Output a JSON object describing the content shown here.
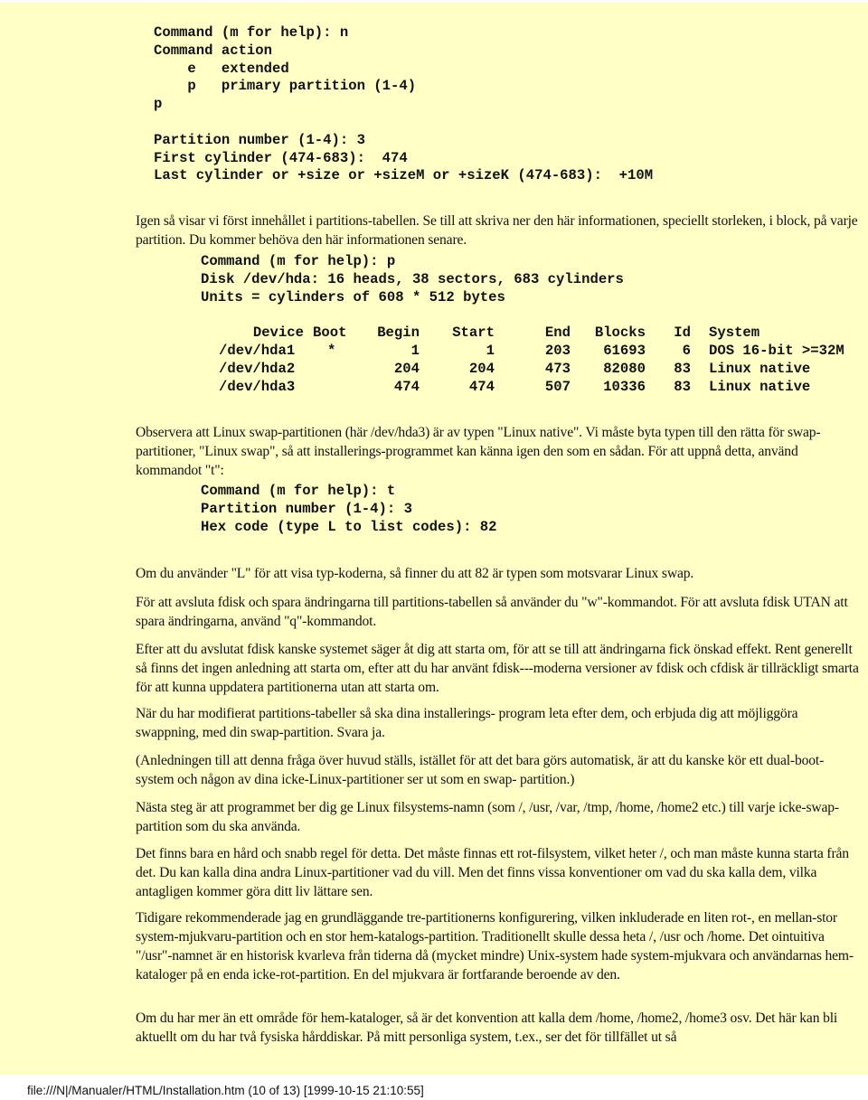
{
  "code_block_1": {
    "lines": [
      "Command (m for help): n",
      "Command action",
      "    e   extended",
      "    p   primary partition (1-4)",
      "p",
      "",
      "Partition number (1-4): 3",
      "First cylinder (474-683):  474",
      "Last cylinder or +size or +sizeM or +sizeK (474-683):  +10M"
    ]
  },
  "paragraph_1": "Igen så visar vi först innehållet i partitions-tabellen. Se till att skriva ner den här informationen, speciellt storleken, i block, på varje partition. Du kommer behöva den här informationen senare.",
  "code_block_2": {
    "lines": [
      "Command (m for help): p",
      "Disk /dev/hda: 16 heads, 38 sectors, 683 cylinders",
      "Units = cylinders of 608 * 512 bytes"
    ]
  },
  "partition_table": {
    "headers": [
      "Device",
      "Boot",
      "Begin",
      "Start",
      "End",
      "Blocks",
      "Id",
      "System"
    ],
    "rows": [
      [
        "/dev/hda1",
        "*",
        "1",
        "1",
        "203",
        "61693",
        "6",
        "DOS 16-bit >=32M"
      ],
      [
        "/dev/hda2",
        "",
        "204",
        "204",
        "473",
        "82080",
        "83",
        "Linux native"
      ],
      [
        "/dev/hda3",
        "",
        "474",
        "474",
        "507",
        "10336",
        "83",
        "Linux native"
      ]
    ]
  },
  "paragraph_2": "Observera att Linux swap-partitionen (här /dev/hda3) är av typen \"Linux native\". Vi måste byta typen till den rätta för swap- partitioner, \"Linux swap\", så att installerings-programmet kan känna igen den som en sådan. För att uppnå detta, använd kommandot \"t\":",
  "code_block_3": {
    "lines": [
      "Command (m for help): t",
      "Partition number (1-4): 3",
      "Hex code (type L to list codes): 82"
    ]
  },
  "paragraphs": [
    "Om du använder \"L\" för att visa typ-koderna, så finner du att 82 är typen som motsvarar Linux swap.",
    "För att avsluta fdisk och spara ändringarna till partitions-tabellen så använder du \"w\"-kommandot. För att avsluta fdisk UTAN att spara ändringarna, använd \"q\"-kommandot.",
    "Efter att du avslutat fdisk kanske systemet säger åt dig att starta om, för att se till att ändringarna fick önskad effekt. Rent generellt så finns det ingen anledning att starta om, efter att du har använt fdisk---moderna versioner av fdisk och cfdisk är tillräckligt smarta för att kunna uppdatera partitionerna utan att starta om.",
    "När du har modifierat partitions-tabeller så ska dina installerings- program leta efter dem, och erbjuda dig att möjliggöra swappning, med din swap-partition. Svara ja.",
    "(Anledningen till att denna fråga över huvud ställs, istället för att det bara görs automatisk, är att du kanske kör ett dual-boot-system och någon av dina icke-Linux-partitioner ser ut som en swap- partition.)",
    "Nästa steg är att programmet ber dig ge Linux filsystems-namn (som /, /usr, /var, /tmp, /home, /home2 etc.) till varje icke-swap-partition som du ska använda.",
    "Det finns bara en hård och snabb regel för detta. Det måste finnas ett rot-filsystem, vilket heter /, och man måste kunna starta från det. Du kan kalla dina andra Linux-partitioner vad du vill. Men det finns vissa konventioner om vad du ska kalla dem, vilka antagligen kommer göra ditt liv lättare sen.",
    "Tidigare rekommenderade jag en grundläggande tre-partitionerns konfigurering, vilken inkluderade en liten rot-, en mellan-stor system-mjukvaru-partition och en stor hem-katalogs-partition. Traditionellt skulle dessa heta /, /usr och /home. Det ointuitiva \"/usr\"-namnet är en historisk kvarleva från tiderna då (mycket mindre) Unix-system hade system-mjukvara och användarnas hem-kataloger på en enda icke-rot-partition. En del mjukvara är fortfarande beroende av den.",
    "Om du har mer än ett område för hem-kataloger, så är det konvention att kalla dem /home, /home2, /home3 osv. Det här kan bli aktuellt om du har två fysiska hårddiskar. På mitt personliga system, t.ex., ser det för tillfället ut så"
  ],
  "footer": "file:///N|/Manualer/HTML/Installation.htm (10 of 13) [1999-10-15 21:10:55]"
}
